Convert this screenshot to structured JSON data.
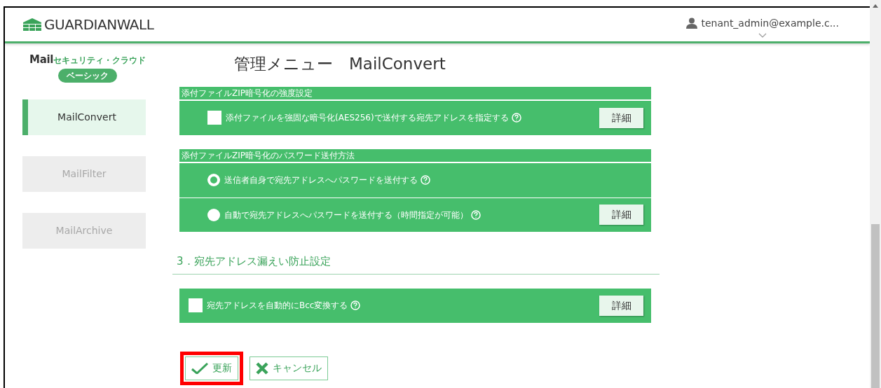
{
  "header": {
    "logo": "GUARDIANWALL",
    "user": "tenant_admin@example.c..."
  },
  "product": {
    "name_mail": "Mail",
    "name_rest": "セキュリティ・クラウド",
    "edition": "ベーシック"
  },
  "sidebar": {
    "items": [
      {
        "label": "MailConvert",
        "selected": true,
        "disabled": false
      },
      {
        "label": "MailFilter",
        "selected": false,
        "disabled": true
      },
      {
        "label": "MailArchive",
        "selected": false,
        "disabled": true
      }
    ]
  },
  "page_title": "管理メニュー　MailConvert",
  "sections": [
    {
      "kind": "panel",
      "title": "添付ファイルZIP暗号化の強度設定",
      "rows": [
        {
          "kind": "checkbox",
          "label": "添付ファイルを強固な暗号化(AES256)で送付する宛先アドレスを指定する",
          "checked": false,
          "button": "詳細"
        }
      ]
    },
    {
      "kind": "panel",
      "title": "添付ファイルZIP暗号化のパスワード送付方法",
      "rows": [
        {
          "kind": "radio",
          "label": "送信者自身で宛先アドレスへパスワードを送付する",
          "selected": true
        },
        {
          "kind": "radio",
          "label": "自動で宛先アドレスへパスワードを送付する（時間指定が可能）",
          "selected": false,
          "button": "詳細"
        }
      ]
    },
    {
      "kind": "heading",
      "title": "3．宛先アドレス漏えい防止設定"
    },
    {
      "kind": "panel",
      "rows": [
        {
          "kind": "checkbox",
          "label": "宛先アドレスを自動的にBcc変換する",
          "checked": false,
          "button": "詳細"
        }
      ]
    }
  ],
  "actions": [
    {
      "kind": "ok",
      "label": "更新",
      "highlighted": true
    },
    {
      "kind": "cancel",
      "label": "キャンセル",
      "highlighted": false
    }
  ]
}
